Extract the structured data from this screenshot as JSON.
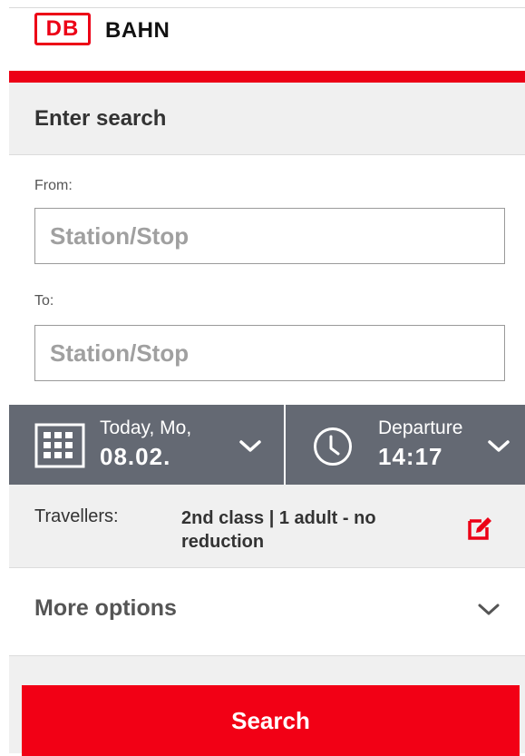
{
  "header": {
    "logo_text": "DB",
    "brand_name": "BAHN"
  },
  "search_panel": {
    "title": "Enter search"
  },
  "from": {
    "label": "From:",
    "value": "",
    "placeholder": "Station/Stop"
  },
  "to": {
    "label": "To:",
    "value": "",
    "placeholder": "Station/Stop"
  },
  "date": {
    "day_label": "Today, Mo,",
    "date_value": "08.02.",
    "icon": "calendar-icon"
  },
  "time": {
    "mode_label": "Departure",
    "time_value": "14:17",
    "icon": "clock-icon"
  },
  "travellers": {
    "label": "Travellers:",
    "value": "2nd class | 1 adult - no reduction",
    "icon": "edit-icon"
  },
  "more_options": {
    "label": "More options"
  },
  "search_button": {
    "label": "Search"
  },
  "colors": {
    "brand_red": "#ec0016",
    "bar_grey": "#646973",
    "panel_grey": "#f0f0f0"
  }
}
